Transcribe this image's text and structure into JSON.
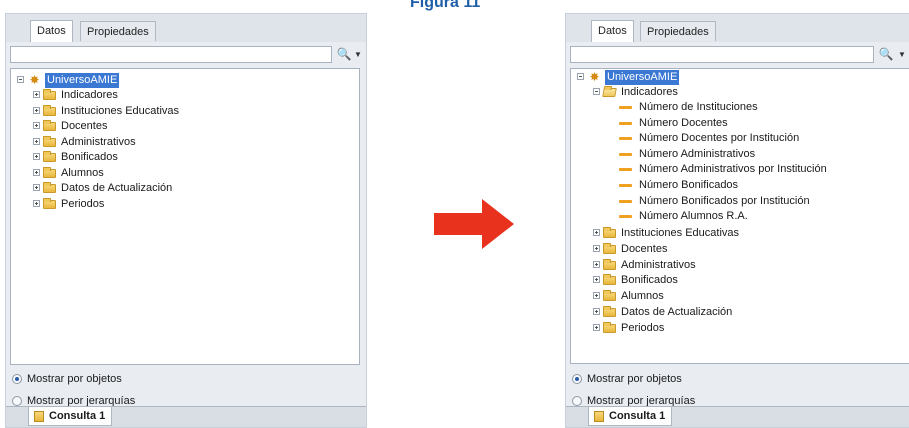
{
  "figure_title": "Figura 11",
  "tabs": {
    "data": "Datos",
    "properties": "Propiedades"
  },
  "root": "UniversoAMIE",
  "left_tree": [
    "Indicadores",
    "Instituciones Educativas",
    "Docentes",
    "Administrativos",
    "Bonificados",
    "Alumnos",
    "Datos de Actualización",
    "Periodos"
  ],
  "right_tree": {
    "expanded": "Indicadores",
    "measures": [
      "Número de Instituciones",
      "Número Docentes",
      "Número Docentes por Institución",
      "Número Administrativos",
      "Número Administrativos por Institución",
      "Número Bonificados",
      "Número Bonificados por Institución",
      "Número Alumnos R.A."
    ],
    "folders": [
      "Instituciones Educativas",
      "Docentes",
      "Administrativos",
      "Bonificados",
      "Alumnos",
      "Datos de Actualización",
      "Periodos"
    ]
  },
  "options": {
    "by_objects": "Mostrar por objetos",
    "by_hierarchies": "Mostrar por jerarquías",
    "selected": "by_objects"
  },
  "query_tab": "Consulta 1",
  "colors": {
    "title": "#1f5ea8",
    "arrow": "#e8321e",
    "selection": "#3a78d4"
  }
}
